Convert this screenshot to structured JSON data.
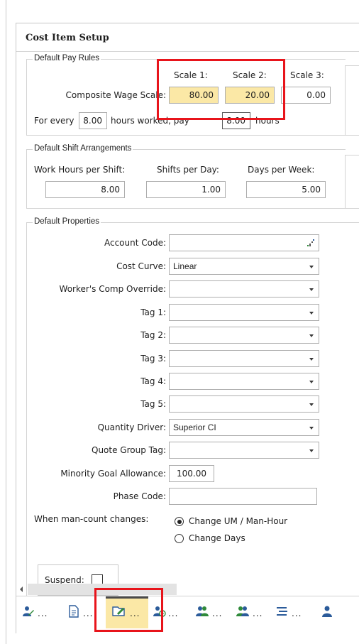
{
  "header": {
    "title": "Cost Item Setup"
  },
  "pay_rules": {
    "legend": "Default Pay Rules",
    "scale1_label": "Scale 1:",
    "scale2_label": "Scale 2:",
    "scale3_label": "Scale 3:",
    "composite_label": "Composite Wage Scale:",
    "scale1_value": "80.00",
    "scale2_value": "20.00",
    "scale3_value": "0.00",
    "for_every_label": "For every",
    "hours_value": "8.00",
    "hours_worked_label": "hours worked, pay",
    "pay_value": "8.00",
    "hours_label": "hours"
  },
  "shift": {
    "legend": "Default Shift Arrangements",
    "work_hours_label": "Work Hours per Shift:",
    "shifts_label": "Shifts per Day:",
    "days_label": "Days per Week:",
    "work_hours_value": "8.00",
    "shifts_value": "1.00",
    "days_value": "5.00"
  },
  "properties": {
    "legend": "Default Properties",
    "account_code_label": "Account Code:",
    "account_code_value": "",
    "cost_curve_label": "Cost Curve:",
    "cost_curve_value": "Linear",
    "workers_comp_label": "Worker's Comp Override:",
    "workers_comp_value": "",
    "tag1_label": "Tag 1:",
    "tag2_label": "Tag 2:",
    "tag3_label": "Tag 3:",
    "tag4_label": "Tag 4:",
    "tag5_label": "Tag 5:",
    "quantity_driver_label": "Quantity Driver:",
    "quantity_driver_value": "Superior CI",
    "quote_group_label": "Quote Group Tag:",
    "quote_group_value": "",
    "minority_goal_label": "Minority Goal Allowance:",
    "minority_goal_value": "100.00",
    "phase_code_label": "Phase Code:",
    "phase_code_value": "",
    "man_count_label": "When man-count changes:",
    "option_change_um": "Change UM / Man-Hour",
    "option_change_days": "Change Days",
    "selected_option": "Change UM / Man-Hour",
    "suspend_label": "Suspend:",
    "suspend_checked": false
  },
  "toolbar": {
    "overflow": "...",
    "buttons": [
      "person-edit-icon",
      "document-icon",
      "folder-open-icon",
      "person-clock-icon",
      "people-add-icon",
      "people-icon",
      "list-indent-icon",
      "person-icon"
    ],
    "active_index": 2
  },
  "colors": {
    "highlight": "#fbe8a6",
    "annotation_red": "#e8141b",
    "icon_green": "#2f8a3a",
    "icon_blue": "#2b5b9a"
  }
}
